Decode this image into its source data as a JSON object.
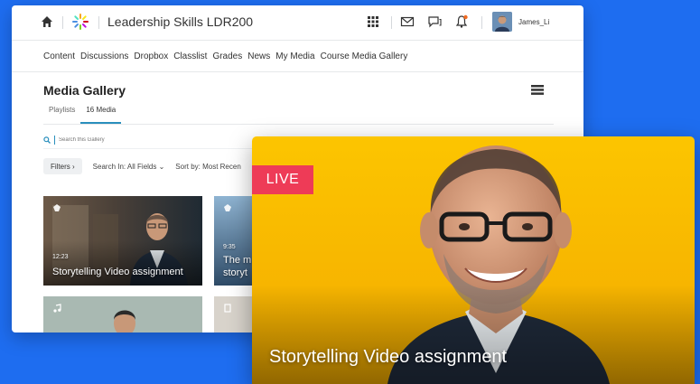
{
  "header": {
    "course_title": "Leadership Skills LDR200",
    "username": "James_Li"
  },
  "nav": {
    "items": [
      {
        "label": "Content"
      },
      {
        "label": "Discussions"
      },
      {
        "label": "Dropbox"
      },
      {
        "label": "Classlist"
      },
      {
        "label": "Grades"
      },
      {
        "label": "News"
      },
      {
        "label": "My Media"
      },
      {
        "label": "Course Media Gallery"
      }
    ]
  },
  "gallery": {
    "title": "Media Gallery",
    "tabs": [
      {
        "label": "Playlists",
        "active": false
      },
      {
        "label": "16 Media",
        "active": true
      }
    ],
    "search_placeholder": "Search this Gallery",
    "filters_label": "Filters ›",
    "search_in": "Search In: All Fields ⌄",
    "sort_by": "Sort by: Most Recen"
  },
  "thumbnails": [
    {
      "duration": "12:23",
      "title": "Storytelling Video assignment"
    },
    {
      "duration": "9:35",
      "title_line1": "The m",
      "title_line2": "storyt"
    }
  ],
  "live_card": {
    "badge": "LIVE",
    "title": "Storytelling Video assignment"
  },
  "colors": {
    "background": "#1e6df0",
    "accent": "#2a8fbd",
    "live_badge": "#ee3b57",
    "live_card_bg": "#fcc500"
  }
}
